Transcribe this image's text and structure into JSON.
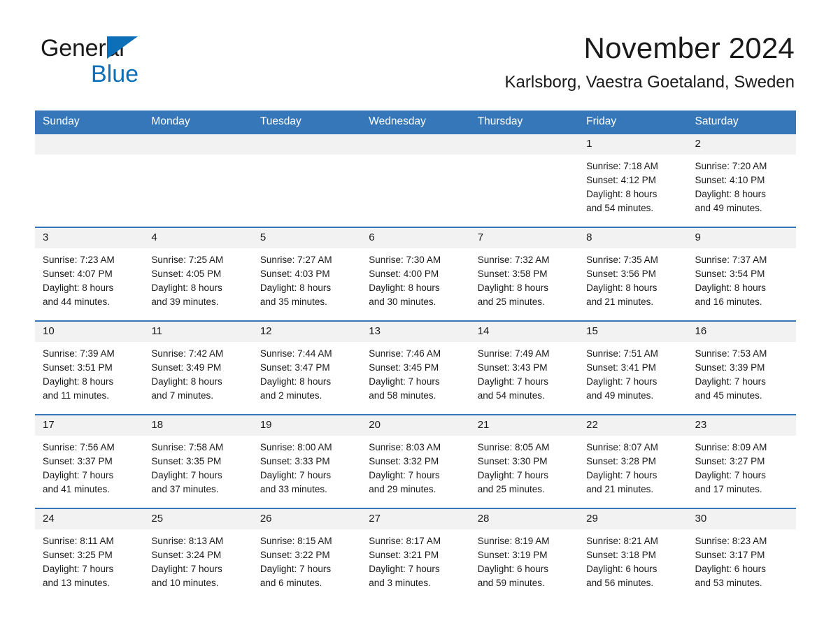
{
  "brand": {
    "name_part1": "General",
    "name_part2": "Blue",
    "accent_color": "#0d6fb8"
  },
  "header": {
    "month_title": "November 2024",
    "location": "Karlsborg, Vaestra Goetaland, Sweden"
  },
  "calendar": {
    "header_color": "#3577b9",
    "daynum_background": "#f2f2f2",
    "weekday_headers": [
      "Sunday",
      "Monday",
      "Tuesday",
      "Wednesday",
      "Thursday",
      "Friday",
      "Saturday"
    ],
    "weeks": [
      [
        {
          "day": "",
          "empty": true
        },
        {
          "day": "",
          "empty": true
        },
        {
          "day": "",
          "empty": true
        },
        {
          "day": "",
          "empty": true
        },
        {
          "day": "",
          "empty": true
        },
        {
          "day": "1",
          "sunrise": "Sunrise: 7:18 AM",
          "sunset": "Sunset: 4:12 PM",
          "daylight_line1": "Daylight: 8 hours",
          "daylight_line2": "and 54 minutes."
        },
        {
          "day": "2",
          "sunrise": "Sunrise: 7:20 AM",
          "sunset": "Sunset: 4:10 PM",
          "daylight_line1": "Daylight: 8 hours",
          "daylight_line2": "and 49 minutes."
        }
      ],
      [
        {
          "day": "3",
          "sunrise": "Sunrise: 7:23 AM",
          "sunset": "Sunset: 4:07 PM",
          "daylight_line1": "Daylight: 8 hours",
          "daylight_line2": "and 44 minutes."
        },
        {
          "day": "4",
          "sunrise": "Sunrise: 7:25 AM",
          "sunset": "Sunset: 4:05 PM",
          "daylight_line1": "Daylight: 8 hours",
          "daylight_line2": "and 39 minutes."
        },
        {
          "day": "5",
          "sunrise": "Sunrise: 7:27 AM",
          "sunset": "Sunset: 4:03 PM",
          "daylight_line1": "Daylight: 8 hours",
          "daylight_line2": "and 35 minutes."
        },
        {
          "day": "6",
          "sunrise": "Sunrise: 7:30 AM",
          "sunset": "Sunset: 4:00 PM",
          "daylight_line1": "Daylight: 8 hours",
          "daylight_line2": "and 30 minutes."
        },
        {
          "day": "7",
          "sunrise": "Sunrise: 7:32 AM",
          "sunset": "Sunset: 3:58 PM",
          "daylight_line1": "Daylight: 8 hours",
          "daylight_line2": "and 25 minutes."
        },
        {
          "day": "8",
          "sunrise": "Sunrise: 7:35 AM",
          "sunset": "Sunset: 3:56 PM",
          "daylight_line1": "Daylight: 8 hours",
          "daylight_line2": "and 21 minutes."
        },
        {
          "day": "9",
          "sunrise": "Sunrise: 7:37 AM",
          "sunset": "Sunset: 3:54 PM",
          "daylight_line1": "Daylight: 8 hours",
          "daylight_line2": "and 16 minutes."
        }
      ],
      [
        {
          "day": "10",
          "sunrise": "Sunrise: 7:39 AM",
          "sunset": "Sunset: 3:51 PM",
          "daylight_line1": "Daylight: 8 hours",
          "daylight_line2": "and 11 minutes."
        },
        {
          "day": "11",
          "sunrise": "Sunrise: 7:42 AM",
          "sunset": "Sunset: 3:49 PM",
          "daylight_line1": "Daylight: 8 hours",
          "daylight_line2": "and 7 minutes."
        },
        {
          "day": "12",
          "sunrise": "Sunrise: 7:44 AM",
          "sunset": "Sunset: 3:47 PM",
          "daylight_line1": "Daylight: 8 hours",
          "daylight_line2": "and 2 minutes."
        },
        {
          "day": "13",
          "sunrise": "Sunrise: 7:46 AM",
          "sunset": "Sunset: 3:45 PM",
          "daylight_line1": "Daylight: 7 hours",
          "daylight_line2": "and 58 minutes."
        },
        {
          "day": "14",
          "sunrise": "Sunrise: 7:49 AM",
          "sunset": "Sunset: 3:43 PM",
          "daylight_line1": "Daylight: 7 hours",
          "daylight_line2": "and 54 minutes."
        },
        {
          "day": "15",
          "sunrise": "Sunrise: 7:51 AM",
          "sunset": "Sunset: 3:41 PM",
          "daylight_line1": "Daylight: 7 hours",
          "daylight_line2": "and 49 minutes."
        },
        {
          "day": "16",
          "sunrise": "Sunrise: 7:53 AM",
          "sunset": "Sunset: 3:39 PM",
          "daylight_line1": "Daylight: 7 hours",
          "daylight_line2": "and 45 minutes."
        }
      ],
      [
        {
          "day": "17",
          "sunrise": "Sunrise: 7:56 AM",
          "sunset": "Sunset: 3:37 PM",
          "daylight_line1": "Daylight: 7 hours",
          "daylight_line2": "and 41 minutes."
        },
        {
          "day": "18",
          "sunrise": "Sunrise: 7:58 AM",
          "sunset": "Sunset: 3:35 PM",
          "daylight_line1": "Daylight: 7 hours",
          "daylight_line2": "and 37 minutes."
        },
        {
          "day": "19",
          "sunrise": "Sunrise: 8:00 AM",
          "sunset": "Sunset: 3:33 PM",
          "daylight_line1": "Daylight: 7 hours",
          "daylight_line2": "and 33 minutes."
        },
        {
          "day": "20",
          "sunrise": "Sunrise: 8:03 AM",
          "sunset": "Sunset: 3:32 PM",
          "daylight_line1": "Daylight: 7 hours",
          "daylight_line2": "and 29 minutes."
        },
        {
          "day": "21",
          "sunrise": "Sunrise: 8:05 AM",
          "sunset": "Sunset: 3:30 PM",
          "daylight_line1": "Daylight: 7 hours",
          "daylight_line2": "and 25 minutes."
        },
        {
          "day": "22",
          "sunrise": "Sunrise: 8:07 AM",
          "sunset": "Sunset: 3:28 PM",
          "daylight_line1": "Daylight: 7 hours",
          "daylight_line2": "and 21 minutes."
        },
        {
          "day": "23",
          "sunrise": "Sunrise: 8:09 AM",
          "sunset": "Sunset: 3:27 PM",
          "daylight_line1": "Daylight: 7 hours",
          "daylight_line2": "and 17 minutes."
        }
      ],
      [
        {
          "day": "24",
          "sunrise": "Sunrise: 8:11 AM",
          "sunset": "Sunset: 3:25 PM",
          "daylight_line1": "Daylight: 7 hours",
          "daylight_line2": "and 13 minutes."
        },
        {
          "day": "25",
          "sunrise": "Sunrise: 8:13 AM",
          "sunset": "Sunset: 3:24 PM",
          "daylight_line1": "Daylight: 7 hours",
          "daylight_line2": "and 10 minutes."
        },
        {
          "day": "26",
          "sunrise": "Sunrise: 8:15 AM",
          "sunset": "Sunset: 3:22 PM",
          "daylight_line1": "Daylight: 7 hours",
          "daylight_line2": "and 6 minutes."
        },
        {
          "day": "27",
          "sunrise": "Sunrise: 8:17 AM",
          "sunset": "Sunset: 3:21 PM",
          "daylight_line1": "Daylight: 7 hours",
          "daylight_line2": "and 3 minutes."
        },
        {
          "day": "28",
          "sunrise": "Sunrise: 8:19 AM",
          "sunset": "Sunset: 3:19 PM",
          "daylight_line1": "Daylight: 6 hours",
          "daylight_line2": "and 59 minutes."
        },
        {
          "day": "29",
          "sunrise": "Sunrise: 8:21 AM",
          "sunset": "Sunset: 3:18 PM",
          "daylight_line1": "Daylight: 6 hours",
          "daylight_line2": "and 56 minutes."
        },
        {
          "day": "30",
          "sunrise": "Sunrise: 8:23 AM",
          "sunset": "Sunset: 3:17 PM",
          "daylight_line1": "Daylight: 6 hours",
          "daylight_line2": "and 53 minutes."
        }
      ]
    ]
  }
}
